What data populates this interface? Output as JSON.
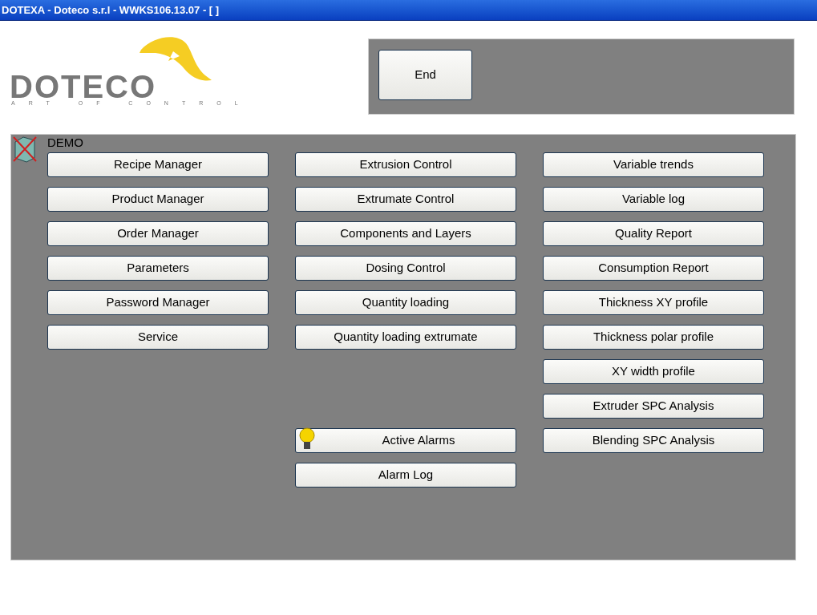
{
  "window": {
    "title": "DOTEXA - Doteco s.r.l - WWKS106.13.07 - [ ]"
  },
  "logo": {
    "name": "DOTECO",
    "tagline": "ART OF CONTROL"
  },
  "end_button": "End",
  "panel": {
    "title": "DEMO",
    "rows": [
      [
        {
          "label": "Recipe Manager",
          "kind": "plain"
        },
        {
          "label": "Extrusion Control",
          "kind": "plain"
        },
        {
          "label": "Variable trends",
          "kind": "plain"
        }
      ],
      [
        {
          "label": "Product Manager",
          "kind": "plain"
        },
        {
          "label": "Extrumate Control",
          "kind": "plain"
        },
        {
          "label": "Variable log",
          "kind": "plain"
        }
      ],
      [
        {
          "label": "Order Manager",
          "kind": "plain"
        },
        {
          "label": "Components and Layers",
          "kind": "plain"
        },
        {
          "label": "Quality Report",
          "kind": "plain"
        }
      ],
      [
        {
          "label": "Parameters",
          "kind": "plain"
        },
        {
          "label": "Dosing Control",
          "kind": "plain"
        },
        {
          "label": "Consumption Report",
          "kind": "plain"
        }
      ],
      [
        {
          "label": "Password Manager",
          "kind": "plain"
        },
        {
          "label": "Quantity loading",
          "kind": "plain"
        },
        {
          "label": "Thickness XY profile",
          "kind": "plain"
        }
      ],
      [
        {
          "label": "Service",
          "kind": "plain"
        },
        {
          "label": "Quantity loading extrumate",
          "kind": "plain"
        },
        {
          "label": "Thickness polar profile",
          "kind": "plain"
        }
      ],
      [
        null,
        null,
        {
          "label": "XY width profile",
          "kind": "plain"
        }
      ],
      [
        null,
        null,
        {
          "label": "Extruder SPC Analysis",
          "kind": "plain"
        }
      ],
      [
        null,
        {
          "label": "Active Alarms",
          "kind": "alarm"
        },
        {
          "label": "Blending SPC Analysis",
          "kind": "plain"
        }
      ],
      [
        null,
        {
          "label": "Alarm Log",
          "kind": "plain"
        },
        null
      ]
    ]
  }
}
